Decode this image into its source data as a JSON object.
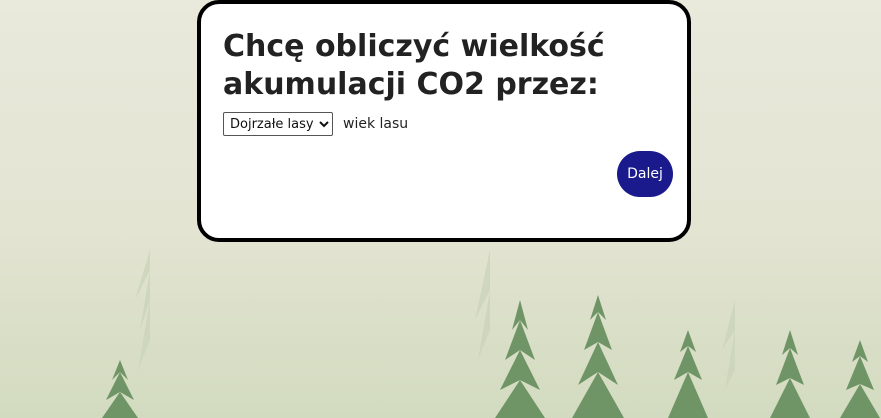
{
  "form": {
    "title": "Chcę obliczyć wielkość akumulacji CO2 przez:",
    "forest_type_select": {
      "selected": "Dojrzałe lasy",
      "options": [
        "Dojrzałe lasy"
      ]
    },
    "forest_age_label": "wiek lasu",
    "next_button": "Dalej"
  },
  "colors": {
    "next_button_bg": "#1a1a8c",
    "card_border": "#000000",
    "card_bg": "#ffffff",
    "title_text": "#222222"
  }
}
